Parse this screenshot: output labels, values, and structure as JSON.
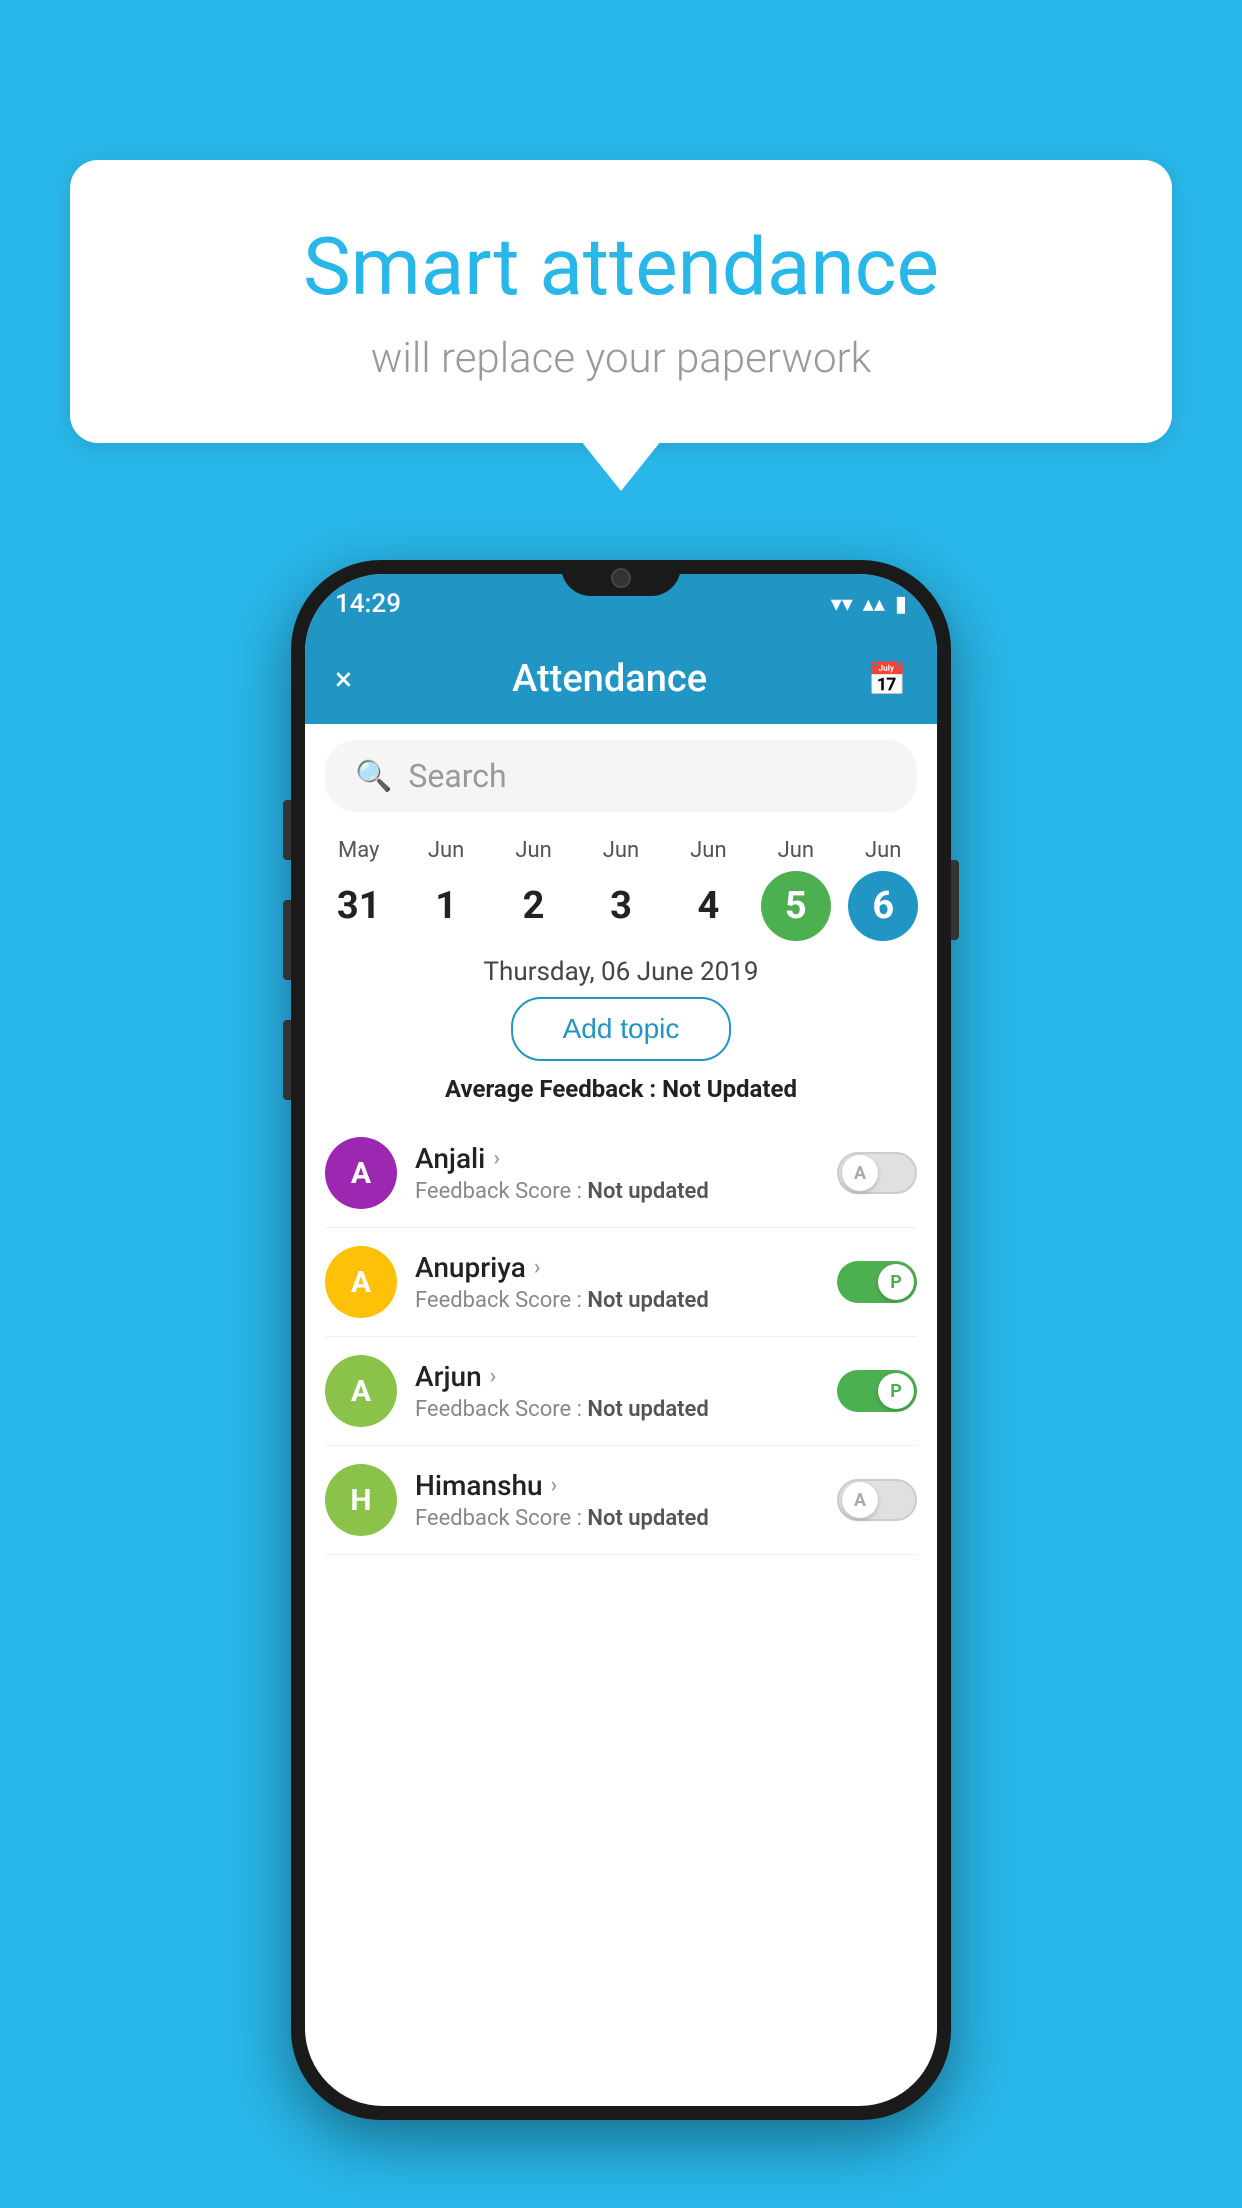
{
  "background_color": "#29b6e8",
  "bubble": {
    "title": "Smart attendance",
    "subtitle": "will replace your paperwork"
  },
  "status_bar": {
    "time": "14:29",
    "wifi": "▾",
    "signal": "▴",
    "battery": "▮"
  },
  "app_bar": {
    "title": "Attendance",
    "close_label": "×",
    "calendar_label": "📅"
  },
  "search": {
    "placeholder": "Search"
  },
  "calendar": {
    "days": [
      {
        "month": "May",
        "date": "31",
        "style": "normal"
      },
      {
        "month": "Jun",
        "date": "1",
        "style": "normal"
      },
      {
        "month": "Jun",
        "date": "2",
        "style": "normal"
      },
      {
        "month": "Jun",
        "date": "3",
        "style": "normal"
      },
      {
        "month": "Jun",
        "date": "4",
        "style": "normal"
      },
      {
        "month": "Jun",
        "date": "5",
        "style": "today"
      },
      {
        "month": "Jun",
        "date": "6",
        "style": "selected"
      }
    ]
  },
  "selected_date_label": "Thursday, 06 June 2019",
  "add_topic_btn": "Add topic",
  "avg_feedback": {
    "label": "Average Feedback : ",
    "value": "Not Updated"
  },
  "students": [
    {
      "name": "Anjali",
      "avatar_letter": "A",
      "avatar_color": "#9c27b0",
      "feedback": "Not updated",
      "toggle": "off",
      "toggle_letter": "A"
    },
    {
      "name": "Anupriya",
      "avatar_letter": "A",
      "avatar_color": "#ffc107",
      "feedback": "Not updated",
      "toggle": "on",
      "toggle_letter": "P"
    },
    {
      "name": "Arjun",
      "avatar_letter": "A",
      "avatar_color": "#8bc34a",
      "feedback": "Not updated",
      "toggle": "on",
      "toggle_letter": "P"
    },
    {
      "name": "Himanshu",
      "avatar_letter": "H",
      "avatar_color": "#8bc34a",
      "feedback": "Not updated",
      "toggle": "off",
      "toggle_letter": "A"
    }
  ]
}
